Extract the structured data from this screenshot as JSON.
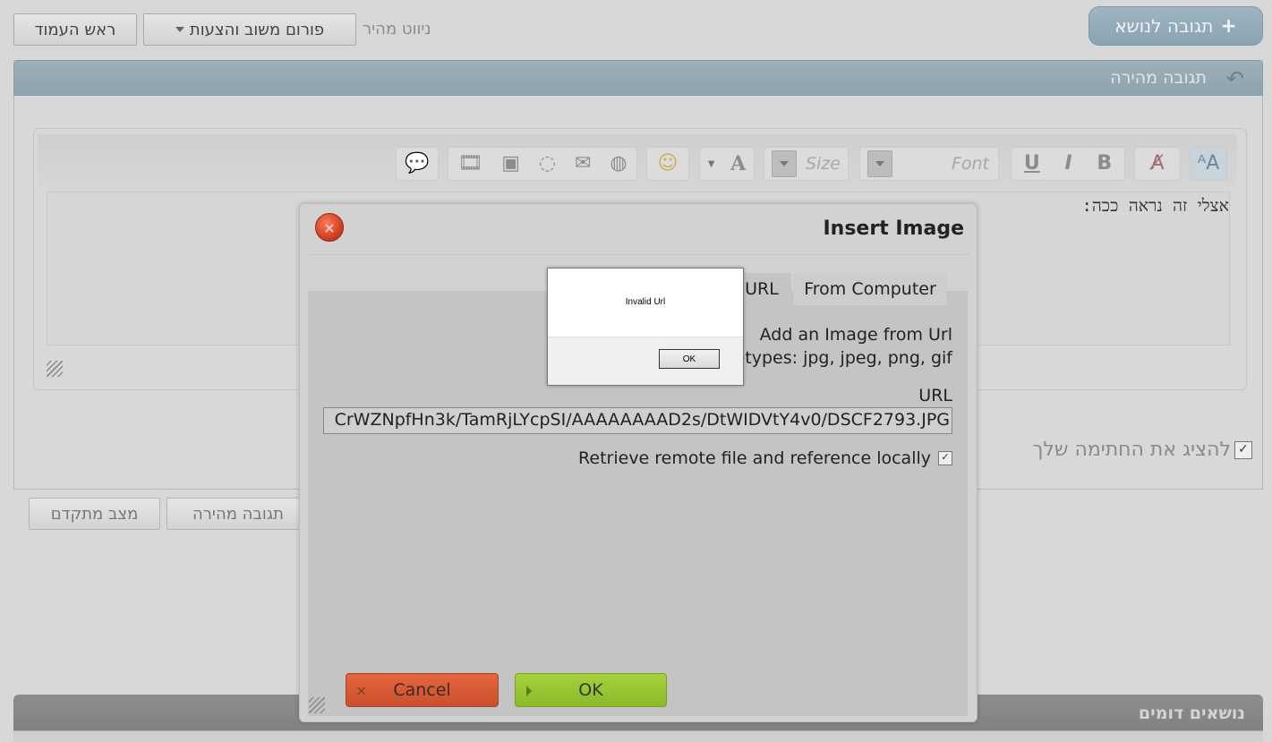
{
  "top_bar": {
    "reply_button": "תגובה לנושא",
    "quick_nav_label": "ניווט מהיר",
    "forum_select": "פורום משוב והצעות",
    "page_top_button": "ראש העמוד"
  },
  "quick_reply": {
    "header": "תגובה מהירה",
    "toolbar": {
      "font_placeholder": "Font",
      "size_placeholder": "Size",
      "bold": "B",
      "italic": "I",
      "underline": "U",
      "color": "A"
    },
    "editor_text": "אצלי זה נראה ככה:",
    "show_signature_label": "להציג את החתימה שלך",
    "show_signature_checked": "✓",
    "advanced_button": "מצב מתקדם",
    "quick_reply_button": "תגובה מהירה"
  },
  "similar_topics": {
    "header": "נושאים דומים"
  },
  "insert_image": {
    "title": "Insert Image",
    "tabs": [
      "URL",
      "From Computer"
    ],
    "add_from_url": "Add an Image from Url",
    "filetypes": "letypes: jpg, jpeg, png, gif",
    "url_label": "URL",
    "url_value": "CrWZNpfHn3k/TamRjLYcpSI/AAAAAAAAD2s/DtWIDVtY4v0/DSCF2793.JPG",
    "retrieve_label": "Retrieve remote file and reference locally",
    "retrieve_checked": "✓",
    "cancel_button": "Cancel",
    "ok_button": "OK"
  },
  "alert": {
    "message": "Invalid Url",
    "ok_button": "OK"
  }
}
